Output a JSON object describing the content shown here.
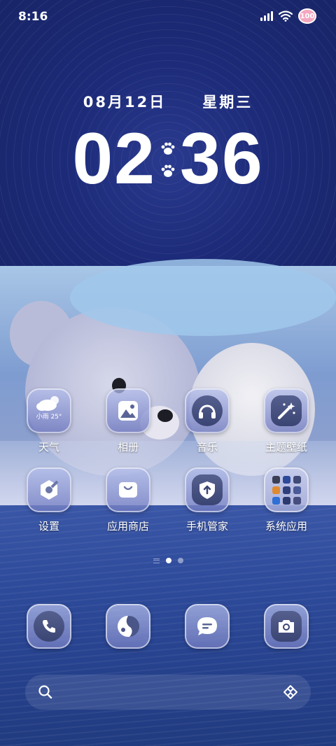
{
  "status_bar": {
    "time": "8:16",
    "battery": "100",
    "icons": [
      "signal-icon",
      "wifi-icon",
      "battery-heart-icon"
    ]
  },
  "clock": {
    "date": "08月12日",
    "weekday": "星期三",
    "hours": "02",
    "minutes": "36"
  },
  "apps": [
    {
      "label": "天气",
      "icon": "weather-icon",
      "badge_text": "小雨 25°"
    },
    {
      "label": "相册",
      "icon": "gallery-icon"
    },
    {
      "label": "音乐",
      "icon": "music-icon"
    },
    {
      "label": "主题壁纸",
      "icon": "theme-wand-icon"
    },
    {
      "label": "设置",
      "icon": "settings-icon"
    },
    {
      "label": "应用商店",
      "icon": "app-store-icon"
    },
    {
      "label": "手机管家",
      "icon": "phone-manager-icon"
    },
    {
      "label": "系统应用",
      "icon": "folder-icon"
    }
  ],
  "page_indicator": {
    "pages": 2,
    "active": 1
  },
  "dock": [
    {
      "icon": "phone-icon"
    },
    {
      "icon": "browser-icon"
    },
    {
      "icon": "messages-icon"
    },
    {
      "icon": "camera-icon"
    }
  ],
  "search_bar": {
    "icons": [
      "search-icon",
      "scan-icon"
    ]
  },
  "colors": {
    "sky": "#1c2a78",
    "sea": "#2d4a9a",
    "icon_inner": "#3b4574"
  }
}
